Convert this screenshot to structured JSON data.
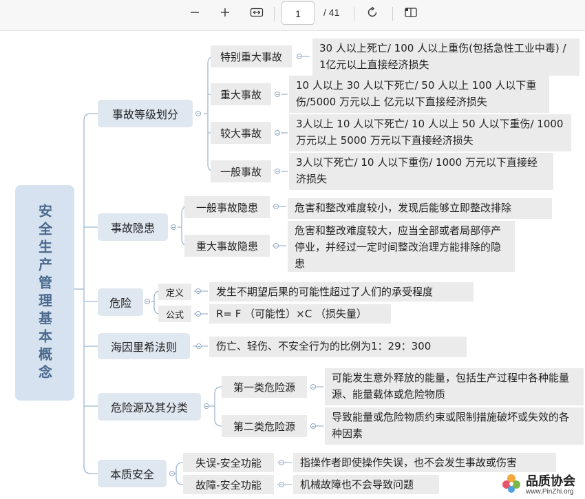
{
  "toolbar": {
    "zoom_out_icon": "minus-icon",
    "zoom_in_icon": "plus-icon",
    "fit_width_icon": "fit-width-icon",
    "page_current": "1",
    "page_total": "/ 41",
    "rotate_icon": "rotate-icon",
    "two_page_icon": "two-page-icon"
  },
  "mindmap": {
    "root": "安全生产管理基本概念",
    "branches": [
      {
        "label": "事故等级划分",
        "children": [
          {
            "label": "特别重大事故",
            "detail": "30 人以上死亡/ 100 人以上重伤(包括急性工业中毒) /1亿元以上直接经济损失"
          },
          {
            "label": "重大事故",
            "detail": "10 人以上 30 人以下死亡/ 50 人以上 100 人以下重伤/5000 万元以上 亿元以下直接经济损失"
          },
          {
            "label": "较大事故",
            "detail": "3人以上 10 人以下死亡/ 10 人以上 50 人以下重伤/ 1000 万元以上 5000 万元以下直接经济损失"
          },
          {
            "label": "一般事故",
            "detail": "3人以下死亡/ 10 人以下重伤/ 1000 万元以下直接经济损失"
          }
        ]
      },
      {
        "label": "事故隐患",
        "children": [
          {
            "label": "一般事故隐患",
            "detail": "危害和整改难度较小，发现后能够立即整改排除"
          },
          {
            "label": "重大事故隐患",
            "detail": "危害和整改难度较大，应当全部或者局部停产停业，并经过一定时间整改治理方能排除的隐患"
          }
        ]
      },
      {
        "label": "危险",
        "children": [
          {
            "label": "定义",
            "detail": "发生不期望后果的可能性超过了人们的承受程度"
          },
          {
            "label": "公式",
            "detail": "R= F （可能性）×C （损失量）"
          }
        ]
      },
      {
        "label": "海因里希法则",
        "detail": "伤亡、轻伤、不安全行为的比例为1：29：300"
      },
      {
        "label": "危险源及其分类",
        "children": [
          {
            "label": "第一类危险源",
            "detail": "可能发生意外释放的能量，包括生产过程中各种能量源、能量载体或危险物质"
          },
          {
            "label": "第二类危险源",
            "detail": "导致能量或危险物质约束或限制措施破坏或失效的各种因素"
          }
        ]
      },
      {
        "label": "本质安全",
        "children": [
          {
            "label": "失误-安全功能",
            "detail": "指操作者即使操作失误，也不会发生事故或伤害"
          },
          {
            "label": "故障-安全功能",
            "detail": "机械故障也不会导致问题"
          }
        ]
      }
    ]
  },
  "watermark": {
    "name": "品质协会",
    "url": "www.PinZhi.org"
  },
  "colors": {
    "connector": "#9fb6cf",
    "root_fill": "#d6e2ef",
    "root_text": "#4a6a8e",
    "branch_fill": "#dfe7f1",
    "leaf_fill": "#ebebeb"
  }
}
